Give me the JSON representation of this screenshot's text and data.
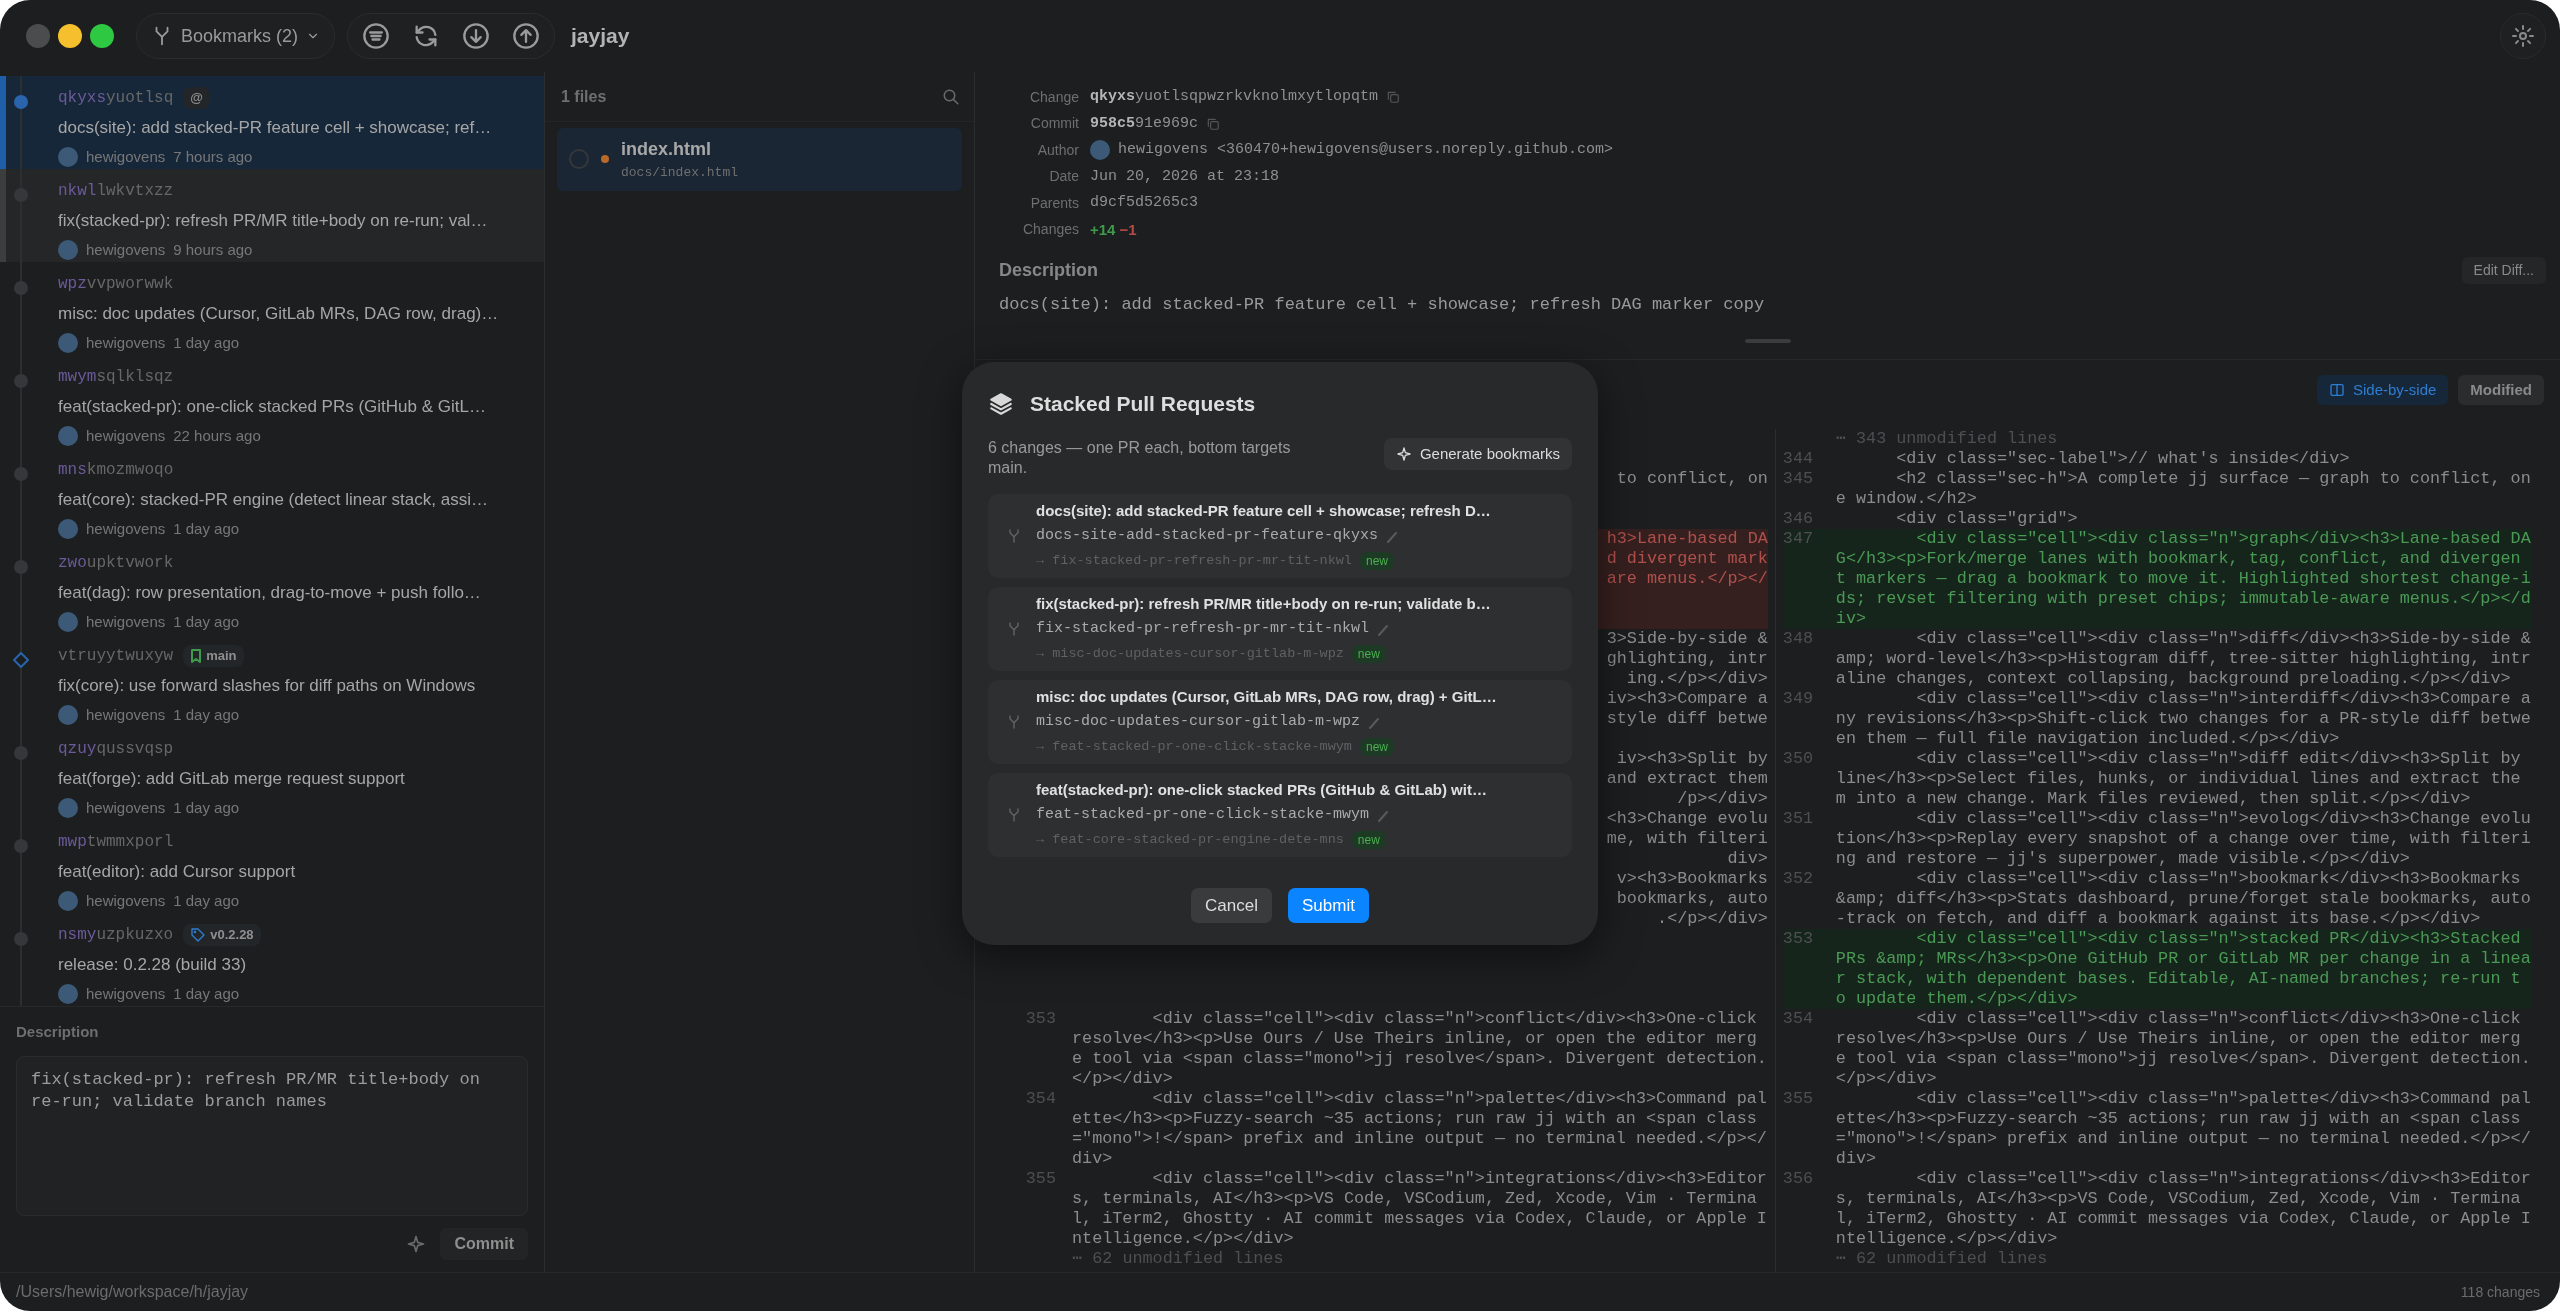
{
  "window": {
    "title": "jayjay"
  },
  "toolbar": {
    "bookmarks_label": "Bookmarks (2)"
  },
  "commits": [
    {
      "id_prefix": "qkyxs",
      "id_rest": "yuotlsq",
      "badges": [
        {
          "kind": "working-copy",
          "label": "@"
        }
      ],
      "title": "docs(site): add stacked-PR feature cell + showcase; ref…",
      "author": "hewigovens",
      "time": "7 hours ago",
      "immutable": false,
      "selected": true,
      "hovered": false
    },
    {
      "id_prefix": "nkwl",
      "id_rest": "lwkvtxzz",
      "title": "fix(stacked-pr): refresh PR/MR title+body on re-run; val…",
      "author": "hewigovens",
      "time": "9 hours ago",
      "immutable": false,
      "selected": false,
      "hovered": true
    },
    {
      "id_prefix": "wpz",
      "id_rest": "vvpworwwk",
      "title": "misc: doc updates (Cursor, GitLab MRs, DAG row, drag)…",
      "author": "hewigovens",
      "time": "1 day ago",
      "immutable": false,
      "selected": false,
      "hovered": false
    },
    {
      "id_prefix": "mwym",
      "id_rest": "sqlklsqz",
      "title": "feat(stacked-pr): one-click stacked PRs (GitHub & GitL…",
      "author": "hewigovens",
      "time": "22 hours ago",
      "immutable": false,
      "selected": false,
      "hovered": false
    },
    {
      "id_prefix": "mns",
      "id_rest": "kmozmwoqo",
      "title": "feat(core): stacked-PR engine (detect linear stack, assi…",
      "author": "hewigovens",
      "time": "1 day ago",
      "immutable": false,
      "selected": false,
      "hovered": false
    },
    {
      "id_prefix": "zwo",
      "id_rest": "upktvwork",
      "title": "feat(dag): row presentation, drag-to-move + push follo…",
      "author": "hewigovens",
      "time": "1 day ago",
      "immutable": false,
      "selected": false,
      "hovered": false
    },
    {
      "id_rest": "vtruyytwuxyw",
      "badges": [
        {
          "kind": "bookmark",
          "label": "main"
        }
      ],
      "title": "fix(core): use forward slashes for diff paths on Windows",
      "author": "hewigovens",
      "time": "1 day ago",
      "immutable": true,
      "selected": false,
      "hovered": false
    },
    {
      "id_prefix": "qzuy",
      "id_rest": "qussvqsp",
      "title": "feat(forge): add GitLab merge request support",
      "author": "hewigovens",
      "time": "1 day ago",
      "immutable": false,
      "selected": false,
      "hovered": false
    },
    {
      "id_prefix": "mwp",
      "id_rest": "twmmxporl",
      "title": "feat(editor): add Cursor support",
      "author": "hewigovens",
      "time": "1 day ago",
      "immutable": false,
      "selected": false,
      "hovered": false
    },
    {
      "id_prefix": "nsmy",
      "id_rest": "uzpkuzxo",
      "badges": [
        {
          "kind": "tag",
          "label": "v0.2.28"
        }
      ],
      "title": "release: 0.2.28 (build 33)",
      "author": "hewigovens",
      "time": "1 day ago",
      "immutable": false,
      "selected": false,
      "hovered": false
    }
  ],
  "commit_description": {
    "label": "Description",
    "text": "fix(stacked-pr): refresh PR/MR title+body on re-run; validate branch names",
    "button": "Commit"
  },
  "files": {
    "count_label": "1 files",
    "items": [
      {
        "name": "index.html",
        "path": "docs/index.html",
        "selected": true,
        "reviewed": false,
        "color": "#b8692a"
      }
    ]
  },
  "details": {
    "fields": [
      {
        "label": "Change",
        "kind": "id",
        "value": "**qkyxs**yuotlsqpwzrkvknolmxytlopqtm"
      },
      {
        "label": "Commit",
        "kind": "id",
        "value": "**958c5**91e969c"
      },
      {
        "label": "Author",
        "kind": "person",
        "value": "hewigovens <360470+hewigovens@users.noreply.github.com>"
      },
      {
        "label": "Date",
        "kind": "plain",
        "value": "Jun 20, 2026 at 23:18"
      },
      {
        "label": "Parents",
        "kind": "plain",
        "value": "d9cf5d5265c3"
      },
      {
        "label": "Changes",
        "kind": "stats",
        "added": "+14",
        "removed": "−1"
      }
    ],
    "description_label": "Description",
    "description": "docs(site): add stacked-PR feature cell + showcase; refresh DAG marker copy",
    "edit_button": "Edit Diff..."
  },
  "diff_toolbar": {
    "view_button": "Side-by-side",
    "status": "Modified"
  },
  "diff": {
    "left": [
      {
        "kind": "blank",
        "removed": false
      },
      {
        "kind": "blank",
        "removed": false
      },
      {
        "kind": "fragment",
        "text": "to conflict, on",
        "removed": false
      },
      {
        "kind": "blank",
        "removed": false
      },
      {
        "kind": "blank",
        "removed": false
      },
      {
        "kind": "fragment",
        "text": "h3>Lane-based DA",
        "removed": true
      },
      {
        "kind": "fragment",
        "text": "d divergent mark",
        "removed": true
      },
      {
        "kind": "fragment",
        "text": "are menus.</p></",
        "removed": true
      },
      {
        "kind": "blank",
        "removed": true
      },
      {
        "kind": "blank",
        "removed": true
      },
      {
        "kind": "fragment",
        "text": "3>Side-by-side &",
        "removed": false
      },
      {
        "kind": "fragment",
        "text": "ghlighting, intr",
        "removed": false
      },
      {
        "kind": "fragment",
        "text": "ing.</p></div>",
        "removed": false
      },
      {
        "kind": "fragment",
        "text": "iv><h3>Compare a",
        "removed": false
      },
      {
        "kind": "fragment",
        "text": "style diff betwe",
        "removed": false
      },
      {
        "kind": "blank",
        "removed": false
      },
      {
        "kind": "fragment",
        "text": "iv><h3>Split by",
        "removed": false
      },
      {
        "kind": "fragment",
        "text": "and extract them",
        "removed": false
      },
      {
        "kind": "fragment",
        "text": "/p></div>",
        "removed": false
      },
      {
        "kind": "fragment",
        "text": "<h3>Change evolu",
        "removed": false
      },
      {
        "kind": "fragment",
        "text": "me, with filteri",
        "removed": false
      },
      {
        "kind": "fragment",
        "text": "div>",
        "removed": false
      },
      {
        "kind": "fragment",
        "text": "v><h3>Bookmarks",
        "removed": false
      },
      {
        "kind": "fragment",
        "text": "bookmarks, auto",
        "removed": false
      },
      {
        "kind": "fragment",
        "text": ".</p></div>",
        "removed": false
      },
      {
        "kind": "blank",
        "removed": false
      },
      {
        "kind": "blank",
        "removed": false
      },
      {
        "kind": "blank",
        "removed": false
      },
      {
        "kind": "blank",
        "removed": false
      },
      {
        "kind": "context",
        "number": "353",
        "text": "        <div class=\"cell\"><div class=\"n\">conflict</div><h3>One-click resolve</h3><p>Use Ours / Use Theirs inline, or open the editor merge tool via <span class=\"mono\">jj resolve</span>. Divergent detection.</p></div>"
      },
      {
        "kind": "context",
        "number": "354",
        "text": "        <div class=\"cell\"><div class=\"n\">palette</div><h3>Command palette</h3><p>Fuzzy-search ~35 actions; run raw jj with an <span class=\"mono\">!</span> prefix and inline output — no terminal needed.</p></div>"
      },
      {
        "kind": "context",
        "number": "355",
        "text": "        <div class=\"cell\"><div class=\"n\">integrations</div><h3>Editors, terminals, AI</h3><p>VS Code, VSCodium, Zed, Xcode, Vim · Terminal, iTerm2, Ghostty · AI commit messages via Codex, Claude, or Apple Intelligence.</p></div>"
      },
      {
        "kind": "collapsed",
        "text": "⋯ 62 unmodified lines"
      }
    ],
    "right": [
      {
        "kind": "collapsed",
        "text": "⋯ 343 unmodified lines"
      },
      {
        "kind": "context",
        "number": "344",
        "text": "      <div class=\"sec-label\">// what's inside</div>"
      },
      {
        "kind": "context",
        "number": "345",
        "text": "      <h2 class=\"sec-h\">A complete jj surface — graph to conflict, one window.</h2>"
      },
      {
        "kind": "context",
        "number": "346",
        "text": "      <div class=\"grid\">"
      },
      {
        "kind": "added",
        "number": "347",
        "text": "        <div class=\"cell\"><div class=\"n\">graph</div><h3>Lane-based DAG</h3><p>Fork/merge lanes with bookmark, tag, conflict, and divergent markers — drag a bookmark to move it. Highlighted shortest change-ids; revset filtering with preset chips; immutable-aware menus.</p></div>"
      },
      {
        "kind": "context",
        "number": "348",
        "text": "        <div class=\"cell\"><div class=\"n\">diff</div><h3>Side-by-side &amp; word-level</h3><p>Histogram diff, tree-sitter highlighting, intraline changes, context collapsing, background preloading.</p></div>"
      },
      {
        "kind": "context",
        "number": "349",
        "text": "        <div class=\"cell\"><div class=\"n\">interdiff</div><h3>Compare any revisions</h3><p>Shift-click two changes for a PR-style diff between them — full file navigation included.</p></div>"
      },
      {
        "kind": "context",
        "number": "350",
        "text": "        <div class=\"cell\"><div class=\"n\">diff edit</div><h3>Split by line</h3><p>Select files, hunks, or individual lines and extract them into a new change. Mark files reviewed, then split.</p></div>"
      },
      {
        "kind": "context",
        "number": "351",
        "text": "        <div class=\"cell\"><div class=\"n\">evolog</div><h3>Change evolution</h3><p>Replay every snapshot of a change over time, with filtering and restore — jj's superpower, made visible.</p></div>"
      },
      {
        "kind": "context",
        "number": "352",
        "text": "        <div class=\"cell\"><div class=\"n\">bookmark</div><h3>Bookmarks &amp; diff</h3><p>Stats dashboard, prune/forget stale bookmarks, auto-track on fetch, and diff a bookmark against its base.</p></div>"
      },
      {
        "kind": "added",
        "number": "353",
        "text": "        <div class=\"cell\"><div class=\"n\">stacked PR</div><h3>Stacked PRs &amp; MRs</h3><p>One GitHub PR or GitLab MR per change in a linear stack, with dependent bases. Editable, AI-named branches; re-run to update them.</p></div>"
      },
      {
        "kind": "context",
        "number": "354",
        "text": "        <div class=\"cell\"><div class=\"n\">conflict</div><h3>One-click resolve</h3><p>Use Ours / Use Theirs inline, or open the editor merge tool via <span class=\"mono\">jj resolve</span>. Divergent detection.</p></div>"
      },
      {
        "kind": "context",
        "number": "355",
        "text": "        <div class=\"cell\"><div class=\"n\">palette</div><h3>Command palette</h3><p>Fuzzy-search ~35 actions; run raw jj with an <span class=\"mono\">!</span> prefix and inline output — no terminal needed.</p></div>"
      },
      {
        "kind": "context",
        "number": "356",
        "text": "        <div class=\"cell\"><div class=\"n\">integrations</div><h3>Editors, terminals, AI</h3><p>VS Code, VSCodium, Zed, Xcode, Vim · Terminal, iTerm2, Ghostty · AI commit messages via Codex, Claude, or Apple Intelligence.</p></div>"
      },
      {
        "kind": "collapsed",
        "text": "⋯ 62 unmodified lines"
      }
    ]
  },
  "modal": {
    "title": "Stacked Pull Requests",
    "subtitle": "6 changes — one PR each, bottom targets main.",
    "generate_button": "Generate bookmarks",
    "items": [
      {
        "title": "docs(site): add stacked-PR feature cell + showcase; refresh D…",
        "branch": "docs-site-add-stacked-pr-feature-qkyxs",
        "target": "→ fix-stacked-pr-refresh-pr-mr-tit-nkwl",
        "badge": "new"
      },
      {
        "title": "fix(stacked-pr): refresh PR/MR title+body on re-run; validate b…",
        "branch": "fix-stacked-pr-refresh-pr-mr-tit-nkwl",
        "target": "→ misc-doc-updates-cursor-gitlab-m-wpz",
        "badge": "new"
      },
      {
        "title": "misc: doc updates (Cursor, GitLab MRs, DAG row, drag) + GitL…",
        "branch": "misc-doc-updates-cursor-gitlab-m-wpz",
        "target": "→ feat-stacked-pr-one-click-stacke-mwym",
        "badge": "new"
      },
      {
        "title": "feat(stacked-pr): one-click stacked PRs (GitHub & GitLab) wit…",
        "branch": "feat-stacked-pr-one-click-stacke-mwym",
        "target": "→ feat-core-stacked-pr-engine-dete-mns",
        "badge": "new"
      }
    ],
    "buttons": [
      {
        "kind": "secondary",
        "label": "Cancel"
      },
      {
        "kind": "primary",
        "label": "Submit"
      }
    ]
  },
  "status_bar": {
    "path": "/Users/hewig/workspace/h/jayjay",
    "summary": "118 changes"
  }
}
